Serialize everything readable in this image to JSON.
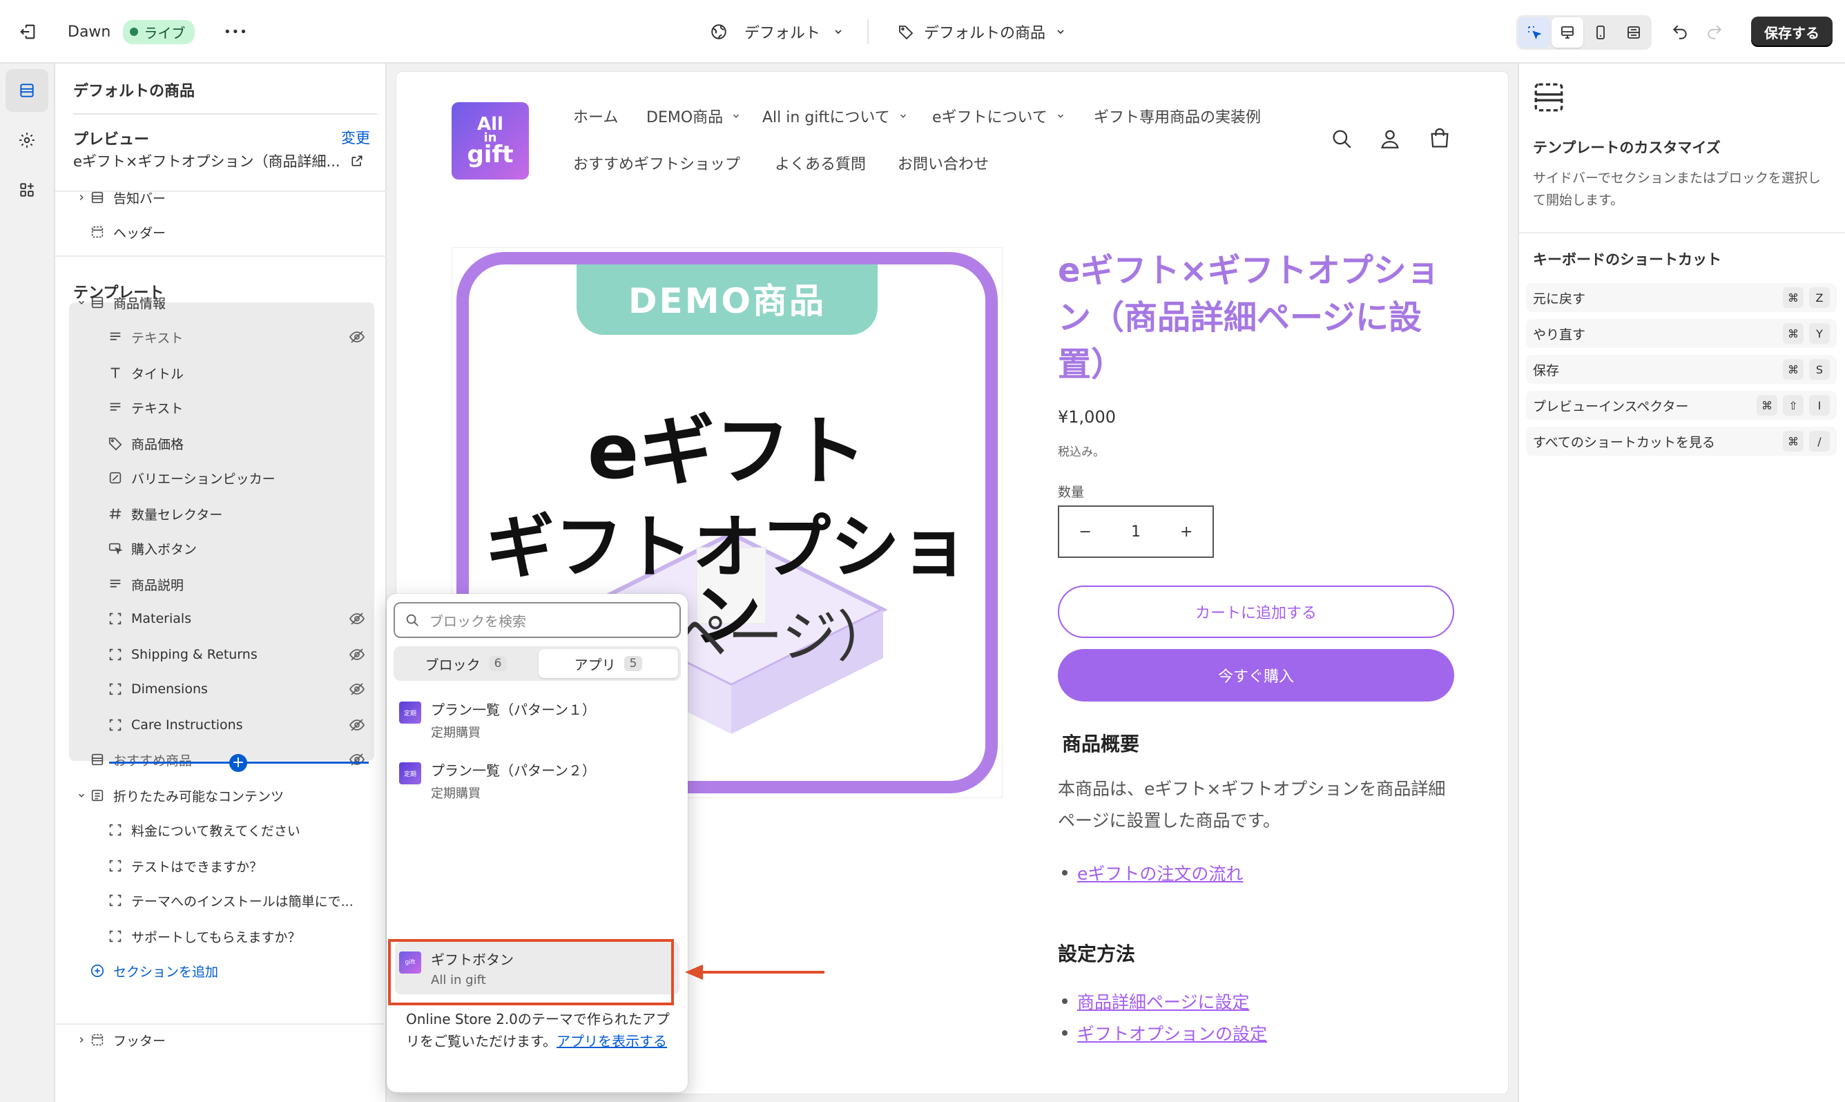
{
  "topbar": {
    "theme_name": "Dawn",
    "live_label": "ライブ",
    "more_label": "•••",
    "theme_selector": "デフォルト",
    "template_selector": "デフォルトの商品",
    "save_label": "保存する"
  },
  "left_panel": {
    "title": "デフォルトの商品",
    "preview_label": "プレビュー",
    "change_label": "変更",
    "preview_value": "eギフト×ギフトオプション（商品詳細...",
    "header_items": [
      {
        "label": "告知バー"
      },
      {
        "label": "ヘッダー"
      }
    ],
    "template_label": "テンプレート",
    "template_items": [
      {
        "label": "商品情報"
      },
      {
        "label": "テキスト"
      },
      {
        "label": "タイトル"
      },
      {
        "label": "テキスト"
      },
      {
        "label": "商品価格"
      },
      {
        "label": "バリエーションピッカー"
      },
      {
        "label": "数量セレクター"
      },
      {
        "label": "購入ボタン"
      },
      {
        "label": "商品説明"
      },
      {
        "label": "Materials"
      },
      {
        "label": "Shipping & Returns"
      },
      {
        "label": "Dimensions"
      },
      {
        "label": "Care Instructions"
      },
      {
        "label": "おすすめ商品"
      },
      {
        "label": "折りたたみ可能なコンテンツ"
      },
      {
        "label": "料金について教えてください"
      },
      {
        "label": "テストはできますか？"
      },
      {
        "label": "テーマへのインストールは簡単にで..."
      },
      {
        "label": "サポートしてもらえますか？"
      }
    ],
    "add_section_label": "セクションを追加",
    "footer_label": "フッター"
  },
  "store": {
    "logo_line1": "All",
    "logo_line2": "in",
    "logo_line3": "gift",
    "nav": [
      {
        "label": "ホーム"
      },
      {
        "label": "DEMO商品"
      },
      {
        "label": "All in giftについて"
      },
      {
        "label": "eギフトについて"
      },
      {
        "label": "ギフト専用商品の実装例"
      },
      {
        "label": "おすすめギフトショップ"
      },
      {
        "label": "よくある質問"
      },
      {
        "label": "お問い合わせ"
      }
    ],
    "image_badge": "DEMO商品",
    "image_line1": "eギフト",
    "image_line2": "ギフトオプション",
    "image_line3": "詳細ページ）",
    "product_title": "eギフト×ギフトオプション（商品詳細ページに設置）",
    "price": "¥1,000",
    "tax_note": "税込み。",
    "quantity_label": "数量",
    "quantity_minus": "−",
    "quantity_value": "1",
    "quantity_plus": "+",
    "add_to_cart": "カートに追加する",
    "buy_now": "今すぐ購入",
    "overview_heading": "商品概要",
    "overview_text": "本商品は、eギフト×ギフトオプションを商品詳細ページに設置した商品です。",
    "overview_link": "eギフトの注文の流れ",
    "setup_heading": "設定方法",
    "setup_links": [
      {
        "label": "商品詳細ページに設定"
      },
      {
        "label": "ギフトオプションの設定"
      }
    ]
  },
  "picker": {
    "search_placeholder": "ブロックを検索",
    "tab_blocks": "ブロック",
    "tab_blocks_count": "6",
    "tab_apps": "アプリ",
    "tab_apps_count": "5",
    "items": [
      {
        "title": "プラン一覧（パターン１）",
        "subtitle": "定期購買"
      },
      {
        "title": "プラン一覧（パターン２）",
        "subtitle": "定期購買"
      },
      {
        "title": "ギフトボタン",
        "subtitle": "All in gift"
      }
    ],
    "footer_text": "Online Store 2.0のテーマで作られたアプリをご覧いただけます。",
    "footer_link": "アプリを表示する"
  },
  "right_panel": {
    "heading": "テンプレートのカスタマイズ",
    "description": "サイドバーでセクションまたはブロックを選択して開始します。",
    "shortcuts_heading": "キーボードのショートカット",
    "shortcuts": [
      {
        "label": "元に戻す",
        "keys": [
          "⌘",
          "Z"
        ]
      },
      {
        "label": "やり直す",
        "keys": [
          "⌘",
          "Y"
        ]
      },
      {
        "label": "保存",
        "keys": [
          "⌘",
          "S"
        ]
      },
      {
        "label": "プレビューインスペクター",
        "keys": [
          "⌘",
          "⇧",
          "I"
        ]
      },
      {
        "label": "すべてのショートカットを見る",
        "keys": [
          "⌘",
          "/"
        ]
      }
    ]
  },
  "colors": {
    "accent_purple": "#a35cf0",
    "title_purple": "#a678e3",
    "admin_blue": "#005bd3",
    "highlight_red": "#e04e2a"
  }
}
